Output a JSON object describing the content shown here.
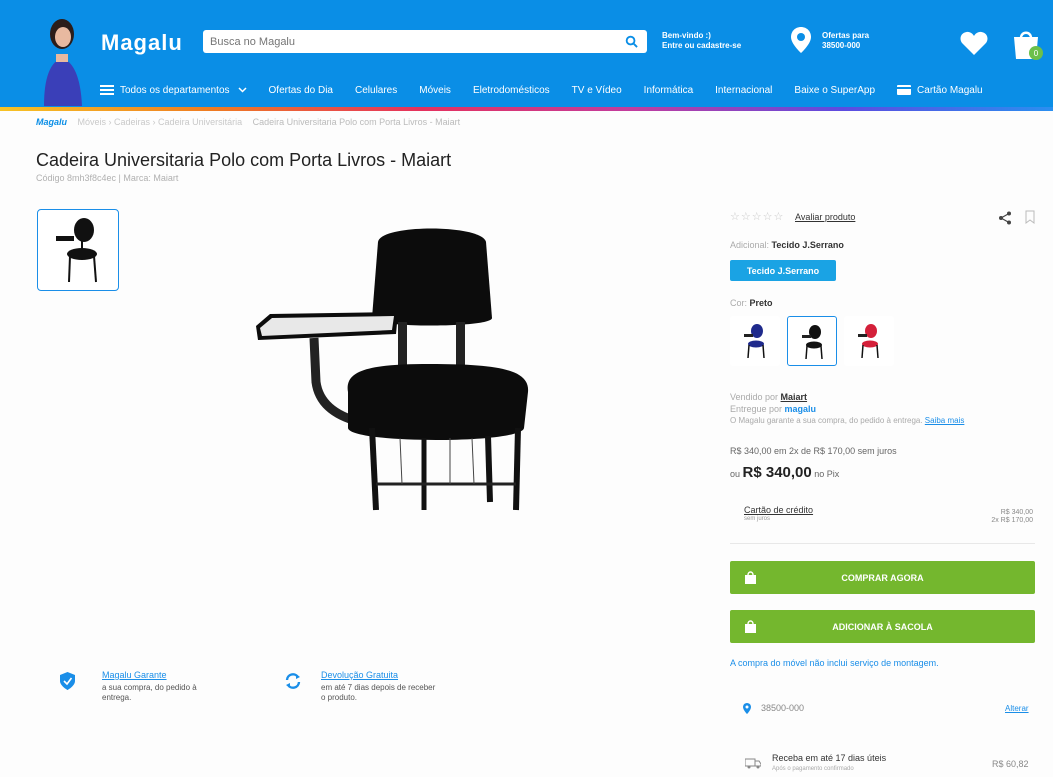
{
  "header": {
    "logo": "Magalu",
    "search_placeholder": "Busca no Magalu",
    "welcome_line1": "Bem-vindo :)",
    "welcome_line2": "Entre ou cadastre-se",
    "offers_line1": "Ofertas para",
    "offers_line2": "38500-000",
    "nav": [
      "Todos os departamentos",
      "Ofertas do Dia",
      "Celulares",
      "Móveis",
      "Eletrodomésticos",
      "TV e Vídeo",
      "Informática",
      "Internacional",
      "Baixe o SuperApp",
      "Cartão Magalu"
    ]
  },
  "breadcrumb": {
    "brand": "Magalu",
    "middle": "Móveis › Cadeiras › Cadeira Universitária",
    "current": "Cadeira Universitaria Polo com Porta Livros - Maiart"
  },
  "product": {
    "title": "Cadeira Universitaria Polo com Porta Livros - Maiart",
    "code_text": "Código 8mh3f8c4ec | Marca: ",
    "code_brand": "Maiart"
  },
  "guarantees": [
    {
      "title": "Magalu Garante",
      "line1": "a sua compra, do pedido à",
      "line2": "entrega."
    },
    {
      "title": "Devolução Gratuita",
      "line1": "em até 7 dias depois de receber",
      "line2": "o produto."
    }
  ],
  "rating": {
    "stars": "☆☆☆☆☆",
    "link": "Avaliar produto"
  },
  "options": {
    "additional_label": "Adicional: ",
    "additional_value": "Tecido J.Serrano",
    "additional_chip": "Tecido J.Serrano",
    "color_label": "Cor: ",
    "color_value": "Preto",
    "colors": [
      {
        "name": "Azul",
        "hex": "#1f2a8c"
      },
      {
        "name": "Preto",
        "hex": "#111111"
      },
      {
        "name": "Vermelho",
        "hex": "#d4203a"
      }
    ]
  },
  "seller": {
    "sold_by_label": "Vendido por ",
    "sold_by": "Maiart",
    "delivered_by_label": "Entregue por ",
    "delivered_by": "magalu",
    "guarantee_text": "O Magalu garante a sua compra, do pedido à entrega. ",
    "guarantee_link": "Saiba mais"
  },
  "pricing": {
    "installments": "R$ 340,00 em 2x de R$ 170,00 sem juros",
    "or_label": "ou ",
    "pix_price": "R$ 340,00",
    "pix_label": " no Pix",
    "card_link": "Cartão de crédito",
    "card_sub": "sem juros",
    "card_val1": "R$ 340,00",
    "card_val2": "2x R$ 170,00"
  },
  "actions": {
    "buy_now": "COMPRAR AGORA",
    "add_to_bag": "ADICIONAR À SACOLA",
    "note": "A compra do móvel não inclui serviço de montagem."
  },
  "shipping": {
    "cep": "38500-000",
    "change": "Alterar",
    "delivery": "Receba em até 17 dias úteis",
    "delivery_sub": "Após o pagamento confirmado",
    "price": "R$ 60,82"
  },
  "colors": {
    "header_bg": "#0a8ee6",
    "primary_blue": "#1a8ee8",
    "buy_green": "#74b72e"
  }
}
